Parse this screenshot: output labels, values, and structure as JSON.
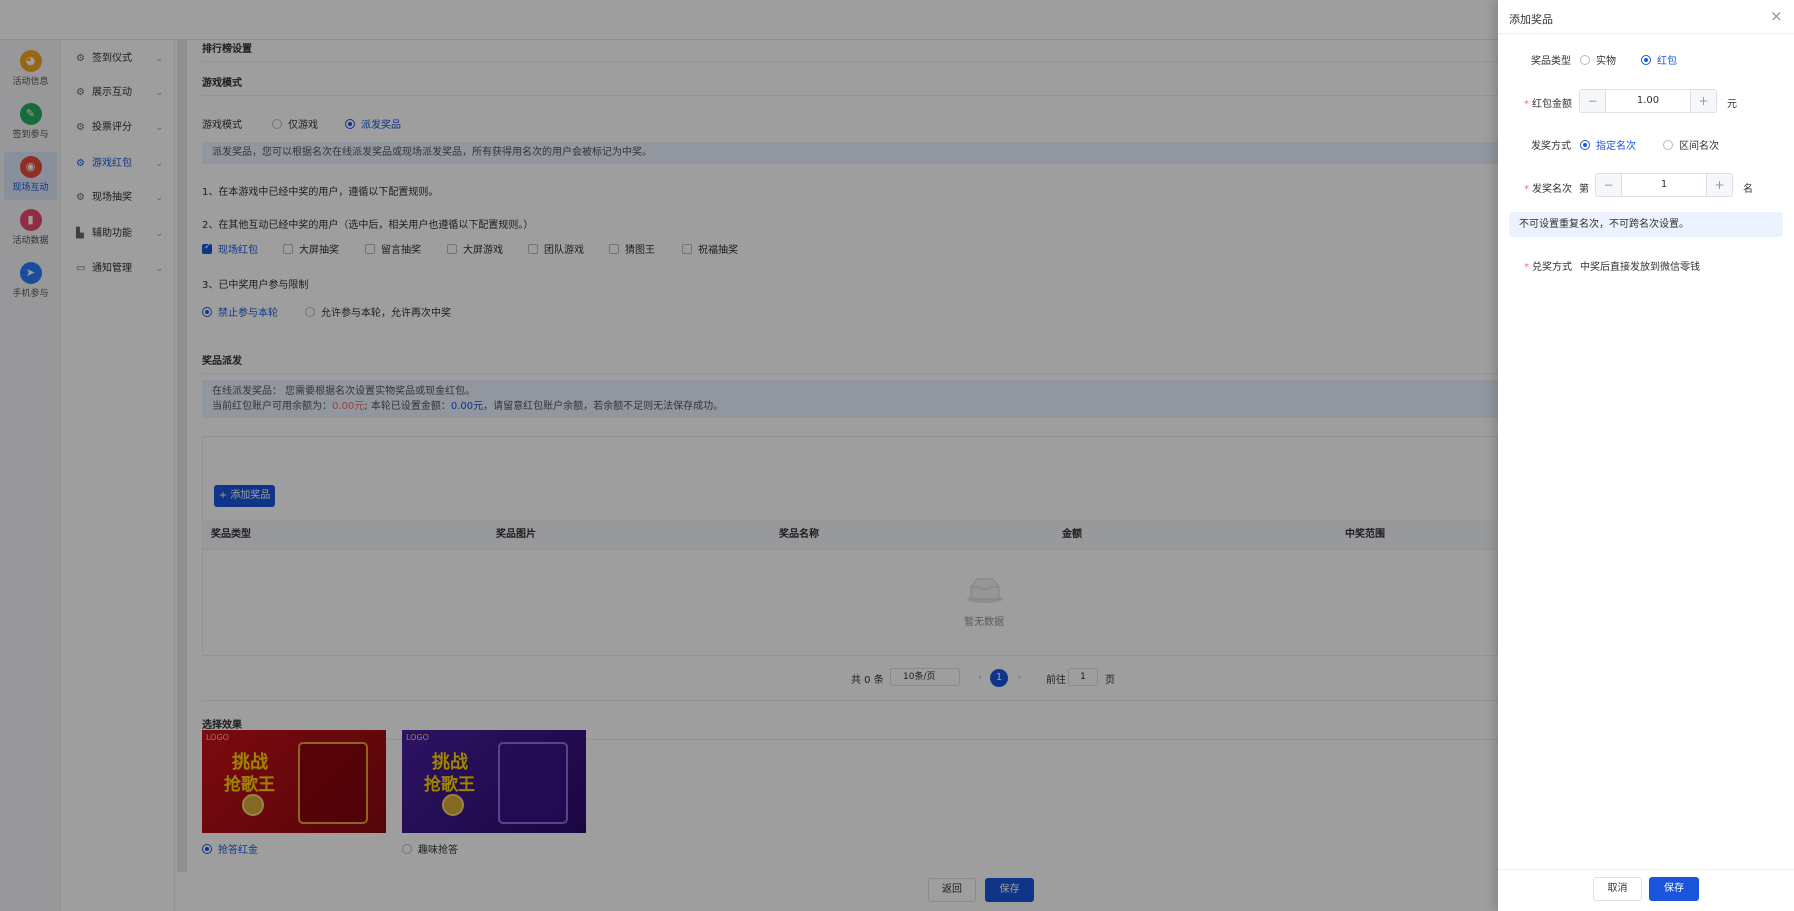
{
  "leftbar": {
    "items": [
      {
        "label": "活动信息",
        "icon": "activity-info-icon",
        "color": "#f5a623",
        "glyph": "◕"
      },
      {
        "label": "签到参与",
        "icon": "signin-icon",
        "color": "#27ae60",
        "glyph": "✎"
      },
      {
        "label": "现场互动",
        "icon": "live-interact-icon",
        "color": "#e84a3b",
        "glyph": "◉"
      },
      {
        "label": "活动数据",
        "icon": "activity-data-icon",
        "color": "#e84a6f",
        "glyph": "▮"
      },
      {
        "label": "手机参与",
        "icon": "mobile-join-icon",
        "color": "#2d7ff9",
        "glyph": "➤"
      }
    ]
  },
  "submenu": {
    "items": [
      {
        "label": "签到仪式",
        "icon": "gear-icon",
        "glyph": "⚙"
      },
      {
        "label": "展示互动",
        "icon": "gear-icon",
        "glyph": "⚙"
      },
      {
        "label": "投票评分",
        "icon": "gear-icon",
        "glyph": "⚙"
      },
      {
        "label": "游戏红包",
        "icon": "gear-icon",
        "glyph": "⚙"
      },
      {
        "label": "现场抽奖",
        "icon": "gear-icon",
        "glyph": "⚙"
      },
      {
        "label": "辅助功能",
        "icon": "chart-icon",
        "glyph": "▙"
      },
      {
        "label": "通知管理",
        "icon": "message-icon",
        "glyph": "▭"
      }
    ],
    "chevron": "⌄"
  },
  "main": {
    "rank_settings": "排行榜设置",
    "game_mode_section": "游戏模式",
    "game_mode_label": "游戏模式",
    "game_mode_options": [
      "仅游戏",
      "派发奖品"
    ],
    "game_mode_info": "派发奖品，您可以根据名次在线派发奖品或现场派发奖品，所有获得用名次的用户会被标记为中奖。",
    "rule1": "1、在本游戏中已经中奖的用户，遵循以下配置规则。",
    "rule2": "2、在其他互动已经中奖的用户（选中后，相关用户也遵循以下配置规则。）",
    "other_activities": [
      "现场红包",
      "大屏抽奖",
      "留言抽奖",
      "大屏游戏",
      "团队游戏",
      "猜图王",
      "祝福抽奖"
    ],
    "rule3": "3、已中奖用户参与限制",
    "restrict_options": [
      "禁止参与本轮",
      "允许参与本轮，允许再次中奖"
    ],
    "prize_section": "奖品派发",
    "prize_info_line1": "在线派发奖品：  您需要根据名次设置实物奖品或现金红包。",
    "prize_info_prefix": "当前红包账户可用余额为：",
    "balance": "0.00元",
    "prize_info_mid": "; 本轮已设置金额：",
    "set_amount": "0.00元",
    "prize_info_suffix": "，请留意红包账户余额，若余额不足则无法保存成功。",
    "add_prize_button": "+ 添加奖品",
    "table_headers": [
      "奖品类型",
      "奖品图片",
      "奖品名称",
      "金额",
      "中奖范围"
    ],
    "empty_text": "暂无数据",
    "pager": {
      "total": "共 0 条",
      "page_size": "10条/页",
      "prev": "‹",
      "current": "1",
      "next": "›",
      "goto_label": "前往",
      "goto_value": "1",
      "page_suffix": "页"
    },
    "effect_section": "选择效果",
    "effects": [
      {
        "label": "抢答红金",
        "logo": "LOGO",
        "title_line1": "挑战",
        "title_line2": "抢歌王",
        "selected": true
      },
      {
        "label": "趣味抢答",
        "logo": "LOGO",
        "title_line1": "挑战",
        "title_line2": "抢歌王",
        "selected": false
      }
    ],
    "back_button": "返回",
    "save_button": "保存"
  },
  "drawer": {
    "title": "添加奖品",
    "close": "×",
    "prize_type_label": "奖品类型",
    "prize_type_options": [
      "实物",
      "红包"
    ],
    "amount_label": "红包金额",
    "amount_value": "1.00",
    "amount_unit": "元",
    "minus": "−",
    "plus": "+",
    "method_label": "发奖方式",
    "method_options": [
      "指定名次",
      "区间名次"
    ],
    "rank_label": "发奖名次",
    "rank_prefix": "第",
    "rank_value": "1",
    "rank_suffix": "名",
    "rank_note": "不可设置重复名次，不可跨名次设置。",
    "redeem_label": "兑奖方式",
    "redeem_value": "中奖后直接发放到微信零钱",
    "cancel_button": "取消",
    "save_button": "保存"
  }
}
